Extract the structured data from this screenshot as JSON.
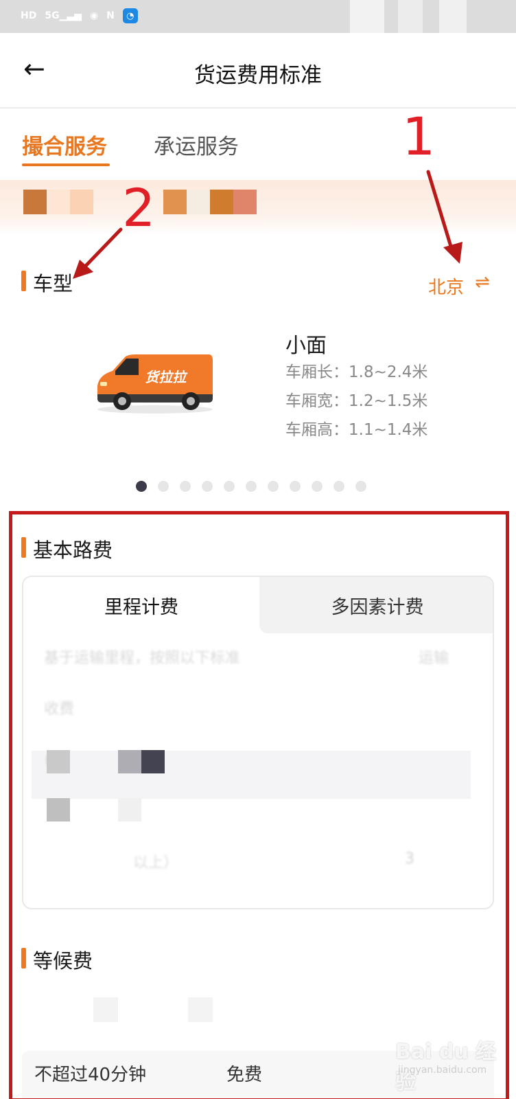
{
  "nav": {
    "back_icon": "←",
    "title": "货运费用标准"
  },
  "tabs": [
    {
      "label": "撮合服务",
      "active": true
    },
    {
      "label": "承运服务",
      "active": false
    }
  ],
  "annotations": {
    "one": "1",
    "two": "2"
  },
  "vehicle_section": {
    "title": "车型",
    "city": "北京",
    "city_switch_icon": "⇌",
    "vehicle": {
      "name": "小面",
      "brand_text": "货拉拉",
      "specs": [
        {
          "label": "车厢长：",
          "value": "1.8~2.4米"
        },
        {
          "label": "车厢宽：",
          "value": "1.2~1.5米"
        },
        {
          "label": "车厢高：",
          "value": "1.1~1.4米"
        }
      ]
    },
    "carousel": {
      "total": 11,
      "active_index": 0
    }
  },
  "basic_fee": {
    "title": "基本路费",
    "tabs": [
      {
        "label": "里程计费",
        "active": true
      },
      {
        "label": "多因素计费",
        "active": false
      }
    ],
    "blurred_lines": [
      "基于运输里程，按照以下标准",
      "运输",
      "收费",
      "00",
      "3",
      "以上）"
    ]
  },
  "waiting_fee": {
    "title": "等候费",
    "rows": [
      {
        "duration": "不超过40分钟",
        "price": "免费"
      }
    ]
  },
  "watermark": {
    "text": "Bai du 经验",
    "sub": "jingyan.baidu.com"
  },
  "colors": {
    "accent": "#e8771f",
    "annotation_red": "#c41a1a",
    "van_orange": "#f07a2a"
  }
}
